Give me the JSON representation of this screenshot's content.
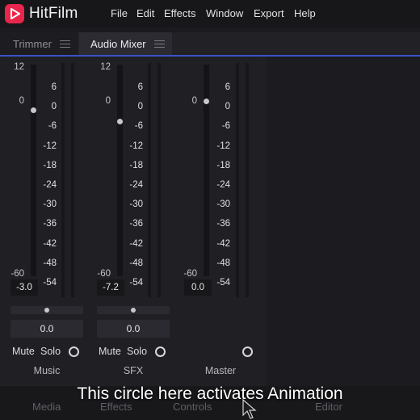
{
  "app": {
    "name": "HitFilm"
  },
  "menu": [
    "File",
    "Edit",
    "Effects",
    "Window",
    "Export",
    "Help"
  ],
  "tabs": [
    {
      "label": "Trimmer",
      "active": false
    },
    {
      "label": "Audio Mixer",
      "active": true
    }
  ],
  "mixer": {
    "db_scale": [
      "6",
      "0",
      "-6",
      "-12",
      "-18",
      "-24",
      "-30",
      "-36",
      "-42",
      "-48",
      "-54"
    ],
    "fader_scale": {
      "top": "12",
      "zero": "0",
      "bottom": "-60"
    },
    "channels": [
      {
        "name": "Music",
        "volume": "-3.0",
        "pan": "0.0",
        "mute_label": "Mute",
        "solo_label": "Solo",
        "fader_fraction": 0.83,
        "pan_fraction": 0.5
      },
      {
        "name": "SFX",
        "volume": "-7.2",
        "pan": "0.0",
        "mute_label": "Mute",
        "solo_label": "Solo",
        "fader_fraction": 0.78,
        "pan_fraction": 0.5
      },
      {
        "name": "Master",
        "volume": "0.0",
        "fader_fraction": 0.87
      }
    ]
  },
  "bottom_tabs": [
    "Media",
    "Effects",
    "Controls",
    "Editor"
  ],
  "caption": "This circle here activates Animation",
  "colors": {
    "accent": "#3b52c8",
    "logo": "#e8254a"
  }
}
